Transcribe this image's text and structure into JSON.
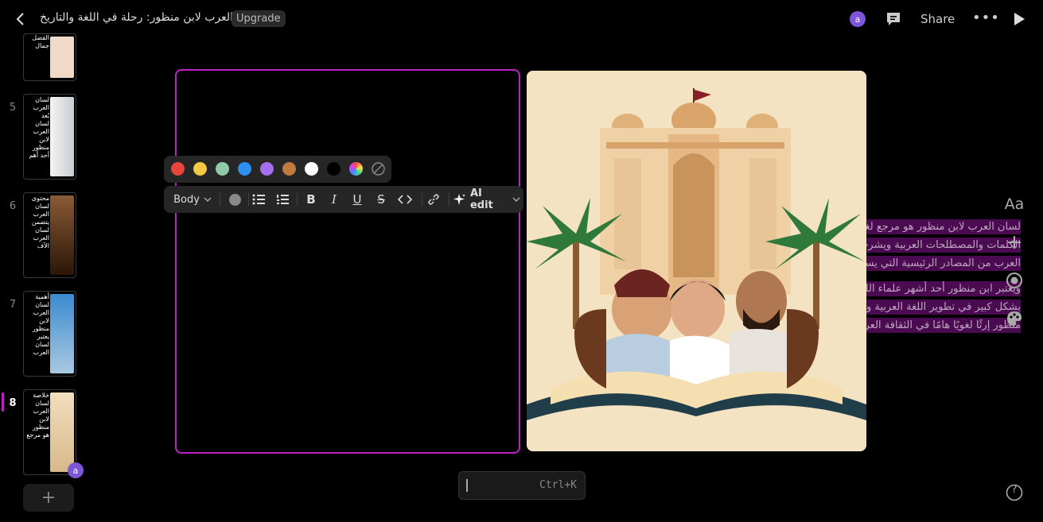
{
  "header": {
    "title": "لسان العرب لابن منظور: رحلة في اللغة والتاريخ",
    "upgrade_label": "Upgrade",
    "avatar_initial": "a",
    "share_label": "Share",
    "more_label": "•••"
  },
  "thumbnails": [
    {
      "number": "",
      "text": "أبو الفضل جمال",
      "image_color": "#f0d9c6"
    },
    {
      "number": "5",
      "text": "لسان العرب يُعد لسان العرب لابن منظور أحد أهم",
      "image_color": "#dfe3e5"
    },
    {
      "number": "6",
      "text": "محتوى لسان العرب يتضمن لسان العرب الآف",
      "image_color": "#6b4226"
    },
    {
      "number": "7",
      "text": "أهمية لسان العرب لابن منظور يعتبر لسان العرب",
      "image_color": "#5a9fd4"
    },
    {
      "number": "8",
      "text": "خلاصة لسان العرب لابن منظور هو مرجع",
      "image_color": "#ead2aa"
    }
  ],
  "thumb_avatar": "a",
  "add_slide_label": "+",
  "slide": {
    "paragraph1": "لسان العرب لابن منظور هو مرجع لغوي كبير في اللغة العربية، يضم آلاف الكلمات والمصطلحات العربية ويشرحها بشكل دقيق وشامل. ويعد لسان العرب من المصادر الرئيسية التي يستخدمها الباحثون في اللغة العربية.",
    "paragraph2": "ويعتبر ابن منظور أحد أشهر علماء اللغة العربية في التاريخ، وقد ساهم بشكل كبير في تطوير اللغة العربية وتوثيق تاريخها. ويمثل لسان العرب لابن منظور إرثًا لغويًا هامًا في الثقافة العربية."
  },
  "color_swatches": [
    "#e8453c",
    "#f5c842",
    "#8fc9a8",
    "#2d8ff0",
    "#a56ef0",
    "#c07a3e",
    "#ffffff",
    "#000000"
  ],
  "format_bar": {
    "style_label": "Body",
    "ai_label": "AI edit"
  },
  "command": {
    "hint": "Ctrl+K"
  },
  "right_tools": {
    "text_label": "Aa",
    "help_label": "?"
  }
}
